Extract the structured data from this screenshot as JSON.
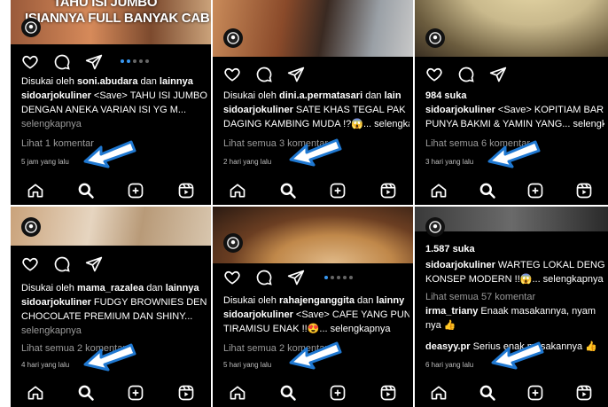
{
  "panels": [
    {
      "photo_caption": [
        "TAHU ISI JUMBO",
        "ISIANNYA FULL BANYAK CAB"
      ],
      "liked_by_prefix": "Disukai oleh ",
      "liked_by_user": "soni.abudara",
      "liked_by_suffix": " dan ",
      "liked_by_others": "lainnya",
      "likes": "",
      "caption_user": "sidoarjokuliner",
      "caption_line1": " <Save> TAHU ISI JUMBO",
      "caption_line2": "DENGAN ANEKA VARIAN ISI YG M...",
      "more": "selengkapnya",
      "comments": "Lihat 1 komentar",
      "time": "5 jam yang lalu"
    },
    {
      "liked_by_prefix": "Disukai oleh ",
      "liked_by_user": "dini.a.permatasari",
      "liked_by_suffix": " dan ",
      "liked_by_others": "lain",
      "caption_user": "sidoarjokuliner",
      "caption_line1": " SATE KHAS TEGAL PAK",
      "caption_line2": "DAGING KAMBING MUDA !?😱... selengkapnya",
      "comments": "Lihat semua 3 komentar",
      "time": "2 hari yang lalu"
    },
    {
      "likes": "984 suka",
      "caption_user": "sidoarjokuliner",
      "caption_line1": " <Save> KOPITIAM BAR",
      "caption_line2": "PUNYA BAKMI & YAMIN YANG... selengkapnya",
      "comments": "Lihat semua 6 komentar",
      "time": "3 hari yang lalu"
    },
    {
      "liked_by_prefix": "Disukai oleh ",
      "liked_by_user": "mama_razalea",
      "liked_by_suffix": " dan ",
      "liked_by_others": "lainnya",
      "caption_user": "sidoarjokuliner",
      "caption_line1": " FUDGY BROWNIES DEN",
      "caption_line2": "CHOCOLATE PREMIUM DAN SHINY...",
      "more": "selengkapnya",
      "comments": "Lihat semua 2 komentar",
      "time": "4 hari yang lalu"
    },
    {
      "liked_by_prefix": "Disukai oleh ",
      "liked_by_user": "rahajenganggita",
      "liked_by_suffix": " dan ",
      "liked_by_others": "lainny",
      "caption_user": "sidoarjokuliner",
      "caption_line1": " <Save> CAFE YANG PUN",
      "caption_line2": "TIRAMISU ENAK !!😍... selengkapnya",
      "comments": "Lihat semua 2 komentar",
      "time": "5 hari yang lalu"
    },
    {
      "likes": "1.587 suka",
      "caption_user": "sidoarjokuliner",
      "caption_line1": " WARTEG LOKAL DENG",
      "caption_line2": "KONSEP MODERN !!😱... selengkapnya",
      "comments": "Lihat semua 57 komentar",
      "comment1_user": "irma_triany",
      "comment1_text": " Enaak masakannya, nyam",
      "comment1_text2": "nya 👍",
      "comment2_user": "deasyy.pr",
      "comment2_text": " Serius enak masakannya 👍",
      "time": "6 hari yang lalu"
    }
  ],
  "colors": {
    "arrow": "#1f78d1",
    "arrow_fill": "#ffffff",
    "muted": "#9a9a9a",
    "dot_active": "#3897f0"
  },
  "icons": [
    "heart-icon",
    "comment-icon",
    "share-icon",
    "home-icon",
    "search-icon",
    "add-post-icon",
    "reels-icon",
    "avatar-icon",
    "arrow-pointer"
  ]
}
